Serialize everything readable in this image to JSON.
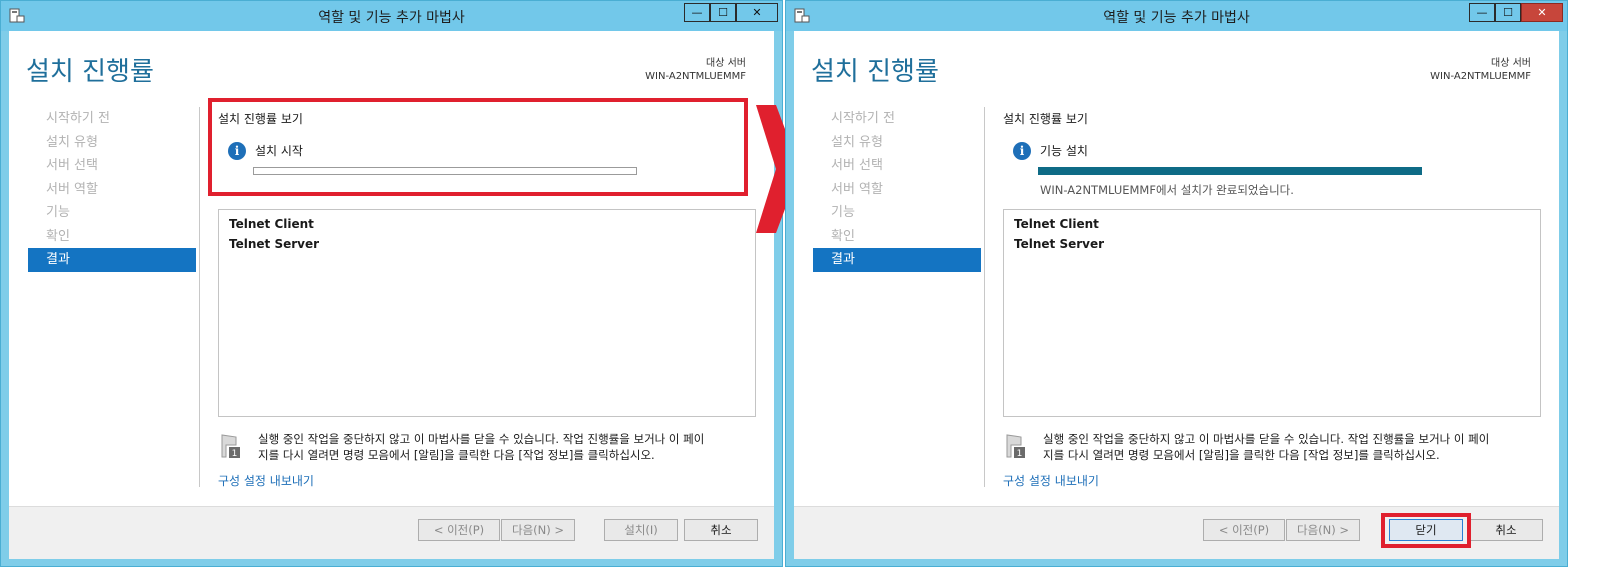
{
  "window_title": "역할 및 기능 추가 마법사",
  "window_buttons": {
    "minimize": "—",
    "maximize": "☐",
    "close": "✕"
  },
  "page_heading": "설치 진행률",
  "target_server": {
    "label": "대상 서버",
    "name": "WIN-A2NTMLUEMMF"
  },
  "nav_items": [
    "시작하기 전",
    "설치 유형",
    "서버 선택",
    "서버 역할",
    "기능",
    "확인",
    "결과"
  ],
  "view_progress_label": "설치 진행률 보기",
  "features": [
    "Telnet Client",
    "Telnet Server"
  ],
  "notice_line1": "실행 중인 작업을 중단하지 않고 이 마법사를 닫을 수 있습니다. 작업 진행률을 보거나 이 페이",
  "notice_line2": "지를 다시 열려면 명령 모음에서 [알림]을 클릭한 다음 [작업 정보]를 클릭하십시오.",
  "export_link": "구성 설정 내보내기",
  "flag_badge": "1",
  "buttons": {
    "previous": "< 이전(P)",
    "next": "다음(N) >",
    "install": "설치(I)",
    "close": "닫기",
    "cancel": "취소"
  },
  "left_window": {
    "status": "설치 시작",
    "progress": 0
  },
  "right_window": {
    "status": "기능 설치",
    "progress": 1.0,
    "result": "WIN-A2NTMLUEMMF에서 설치가 완료되었습니다."
  },
  "colors": {
    "accent": "#1474c2",
    "title_bar": "#72c8ea",
    "highlight": "#e0202e",
    "progress_fill": "#0e6b86",
    "link": "#1e6fb8"
  }
}
